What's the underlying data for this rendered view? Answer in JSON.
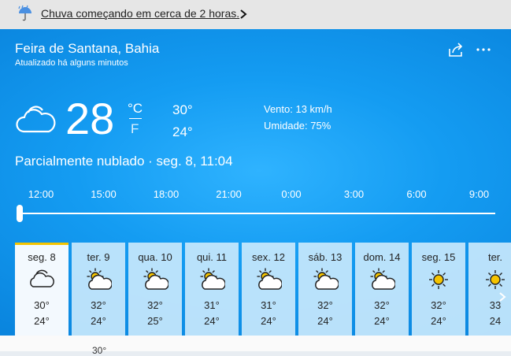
{
  "alert": {
    "text": "Chuva começando em cerca de 2 horas.",
    "icon": "umbrella-rain-icon"
  },
  "location": {
    "city": "Feira de Santana, Bahia",
    "updated": "Atualizado há alguns minutos"
  },
  "current": {
    "temperature": "28",
    "unit_c": "°C",
    "unit_f": "F",
    "high": "30°",
    "low": "24°",
    "wind": "Vento: 13 km/h",
    "humidity": "Umidade: 75%",
    "condition": "Parcialmente nublado · seg. 8, 11:04",
    "icon": "cloud-icon"
  },
  "hourly": [
    "12:00",
    "15:00",
    "18:00",
    "21:00",
    "0:00",
    "3:00",
    "6:00",
    "9:00"
  ],
  "timeline": {
    "position": 0
  },
  "days": [
    {
      "name": "seg. 8",
      "high": "30°",
      "low": "24°",
      "icon": "cloudy"
    },
    {
      "name": "ter. 9",
      "high": "32°",
      "low": "24°",
      "icon": "partly-sunny"
    },
    {
      "name": "qua. 10",
      "high": "32°",
      "low": "25°",
      "icon": "partly-sunny"
    },
    {
      "name": "qui. 11",
      "high": "31°",
      "low": "24°",
      "icon": "partly-sunny"
    },
    {
      "name": "sex. 12",
      "high": "31°",
      "low": "24°",
      "icon": "partly-sunny"
    },
    {
      "name": "sáb. 13",
      "high": "32°",
      "low": "24°",
      "icon": "partly-sunny"
    },
    {
      "name": "dom. 14",
      "high": "32°",
      "low": "24°",
      "icon": "partly-sunny"
    },
    {
      "name": "seg. 15",
      "high": "32°",
      "low": "24°",
      "icon": "sunny"
    },
    {
      "name": "ter.",
      "high": "33",
      "low": "24",
      "icon": "sunny"
    }
  ],
  "bottom": {
    "text": "30°"
  },
  "colors": {
    "panel": "#149cf2",
    "selected_bar": "#f5c400",
    "alert_bg": "#e6e6e6"
  }
}
